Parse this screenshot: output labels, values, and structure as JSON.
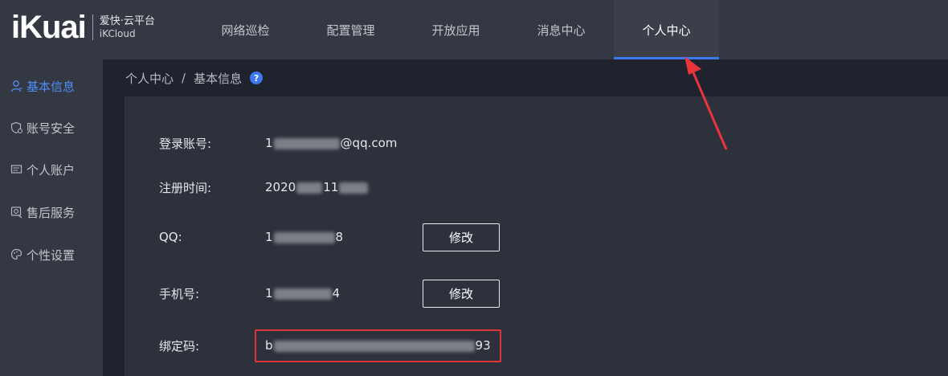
{
  "app": {
    "logo_mark": "iKuai",
    "logo_cn": "爱快·云平台",
    "logo_en": "iKCloud"
  },
  "nav": {
    "items": [
      {
        "label": "网络巡检"
      },
      {
        "label": "配置管理"
      },
      {
        "label": "开放应用"
      },
      {
        "label": "消息中心"
      },
      {
        "label": "个人中心",
        "active": true
      }
    ]
  },
  "sidebar": {
    "items": [
      {
        "label": "基本信息",
        "icon": "user-icon",
        "active": true
      },
      {
        "label": "账号安全",
        "icon": "shield-icon"
      },
      {
        "label": "个人账户",
        "icon": "account-card-icon"
      },
      {
        "label": "售后服务",
        "icon": "service-icon"
      },
      {
        "label": "个性设置",
        "icon": "palette-icon"
      }
    ]
  },
  "breadcrumb": {
    "parent": "个人中心",
    "separator": "/",
    "current": "基本信息",
    "help": "?"
  },
  "profile": {
    "account_label": "登录账号:",
    "account_prefix": "1",
    "account_suffix": "@qq.com",
    "register_label": "注册时间:",
    "register_prefix": "2020",
    "register_mid": "11",
    "qq_label": "QQ:",
    "qq_prefix": "1",
    "qq_suffix": "8",
    "qq_edit": "修改",
    "phone_label": "手机号:",
    "phone_prefix": "1",
    "phone_suffix": "4",
    "phone_edit": "修改",
    "bind_label": "绑定码:",
    "bind_prefix": "b",
    "bind_suffix": "93"
  },
  "colors": {
    "accent": "#3c78f0",
    "highlight_box": "#e0353b",
    "annotation_arrow": "#e8343a"
  }
}
